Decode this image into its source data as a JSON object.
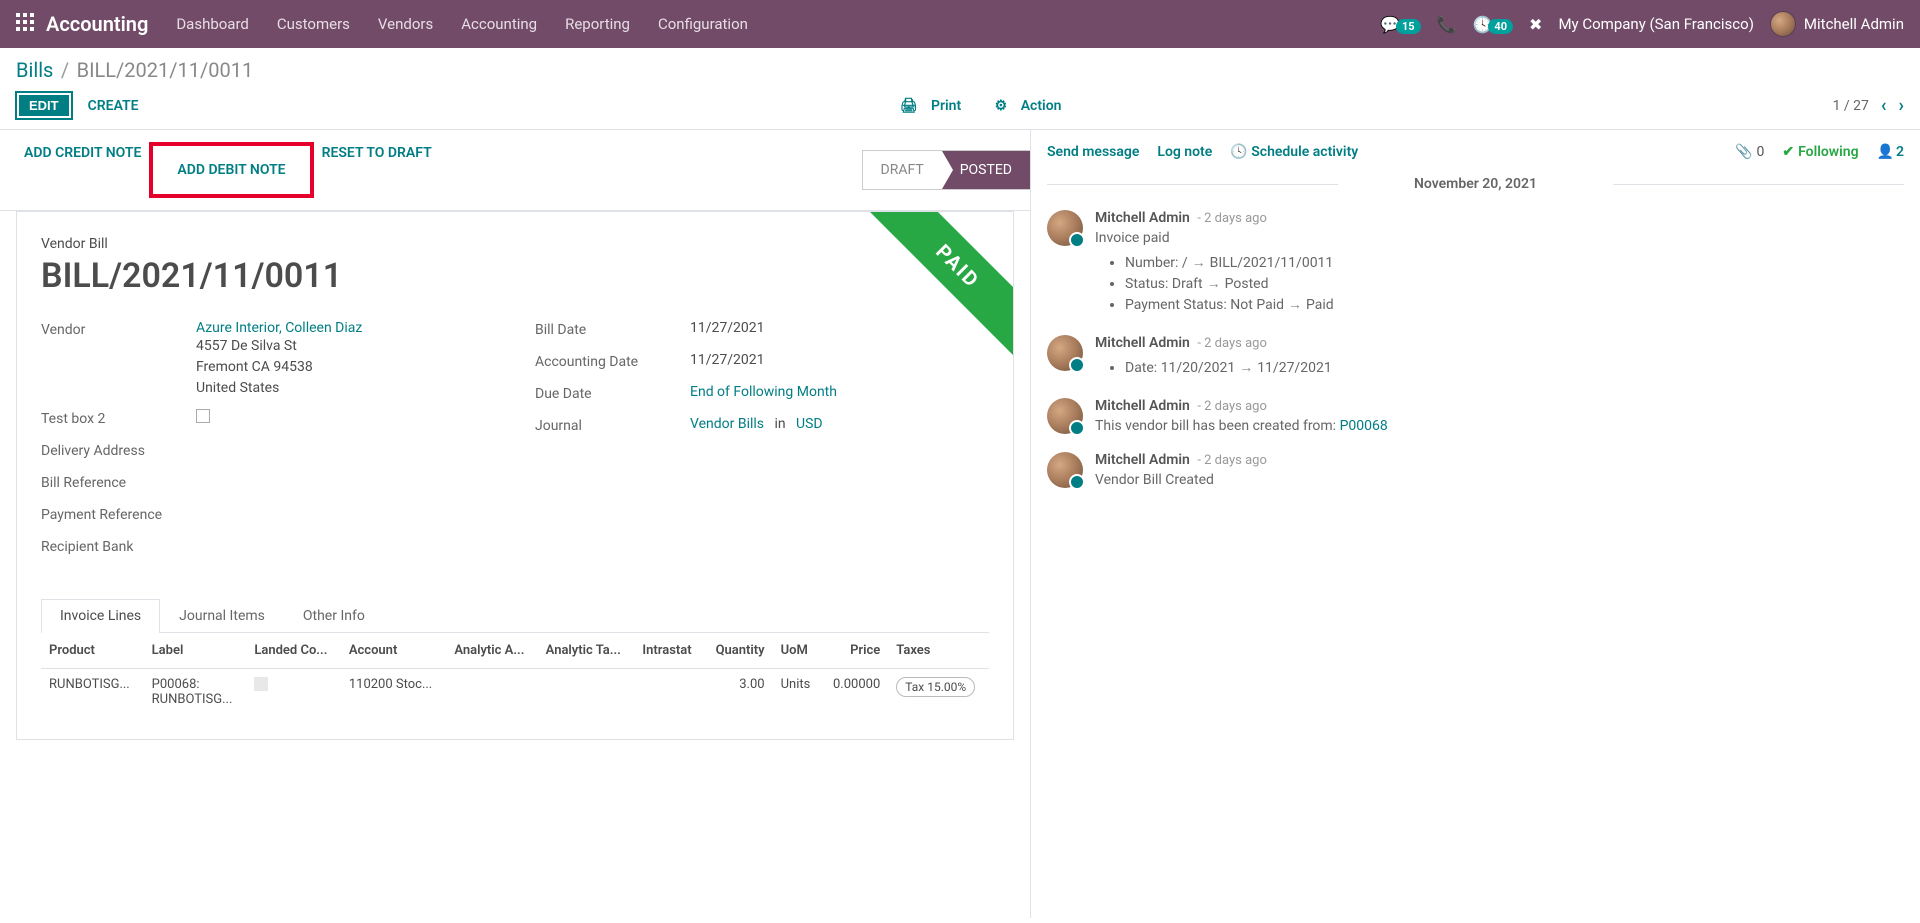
{
  "topnav": {
    "brand": "Accounting",
    "menu": [
      "Dashboard",
      "Customers",
      "Vendors",
      "Accounting",
      "Reporting",
      "Configuration"
    ],
    "msg_count": "15",
    "call_count": "40",
    "company": "My Company (San Francisco)",
    "user": "Mitchell Admin"
  },
  "breadcrumb": {
    "parent": "Bills",
    "current": "BILL/2021/11/0011"
  },
  "actions": {
    "edit": "EDIT",
    "create": "CREATE",
    "print": "Print",
    "action": "Action",
    "pager": "1 / 27"
  },
  "statusbar": {
    "add_credit": "ADD CREDIT NOTE",
    "add_debit": "ADD DEBIT NOTE",
    "reset": "RESET TO DRAFT",
    "stages": [
      "DRAFT",
      "POSTED"
    ]
  },
  "form": {
    "subtitle": "Vendor Bill",
    "title": "BILL/2021/11/0011",
    "ribbon": "PAID",
    "left": {
      "vendor_label": "Vendor",
      "vendor_name": "Azure Interior, Colleen Diaz",
      "vendor_addr1": "4557 De Silva St",
      "vendor_addr2": "Fremont CA 94538",
      "vendor_addr3": "United States",
      "testbox_label": "Test box 2",
      "delivery_label": "Delivery Address",
      "billref_label": "Bill Reference",
      "payref_label": "Payment Reference",
      "bank_label": "Recipient Bank"
    },
    "right": {
      "billdate_label": "Bill Date",
      "billdate": "11/27/2021",
      "acctdate_label": "Accounting Date",
      "acctdate": "11/27/2021",
      "duedate_label": "Due Date",
      "duedate": "End of Following Month",
      "journal_label": "Journal",
      "journal": "Vendor Bills",
      "journal_in": "in",
      "journal_cur": "USD"
    }
  },
  "tabs": [
    "Invoice Lines",
    "Journal Items",
    "Other Info"
  ],
  "table": {
    "headers": [
      "Product",
      "Label",
      "Landed Co...",
      "Account",
      "Analytic A...",
      "Analytic Ta...",
      "Intrastat",
      "Quantity",
      "UoM",
      "Price",
      "Taxes"
    ],
    "row": {
      "product": "RUNBOTISG...",
      "label1": "P00068:",
      "label2": "RUNBOTISG...",
      "account": "110200 Stoc...",
      "qty": "3.00",
      "uom": "Units",
      "price": "0.00000",
      "tax": "Tax 15.00%"
    }
  },
  "chatter": {
    "send": "Send message",
    "log": "Log note",
    "schedule": "Schedule activity",
    "attach_count": "0",
    "following": "Following",
    "followers": "2",
    "date_sep": "November 20, 2021",
    "msgs": [
      {
        "author": "Mitchell Admin",
        "time": "- 2 days ago",
        "text": "Invoice paid",
        "items": [
          {
            "k": "Number:",
            "from": "/",
            "to": "BILL/2021/11/0011"
          },
          {
            "k": "Status:",
            "from": "Draft",
            "to": "Posted"
          },
          {
            "k": "Payment Status:",
            "from": "Not Paid",
            "to": "Paid"
          }
        ]
      },
      {
        "author": "Mitchell Admin",
        "time": "- 2 days ago",
        "items": [
          {
            "k": "Date:",
            "from": "11/20/2021",
            "to": "11/27/2021"
          }
        ]
      },
      {
        "author": "Mitchell Admin",
        "time": "- 2 days ago",
        "text": "This vendor bill has been created from:",
        "ref": "P00068"
      },
      {
        "author": "Mitchell Admin",
        "time": "- 2 days ago",
        "text": "Vendor Bill Created"
      }
    ]
  }
}
